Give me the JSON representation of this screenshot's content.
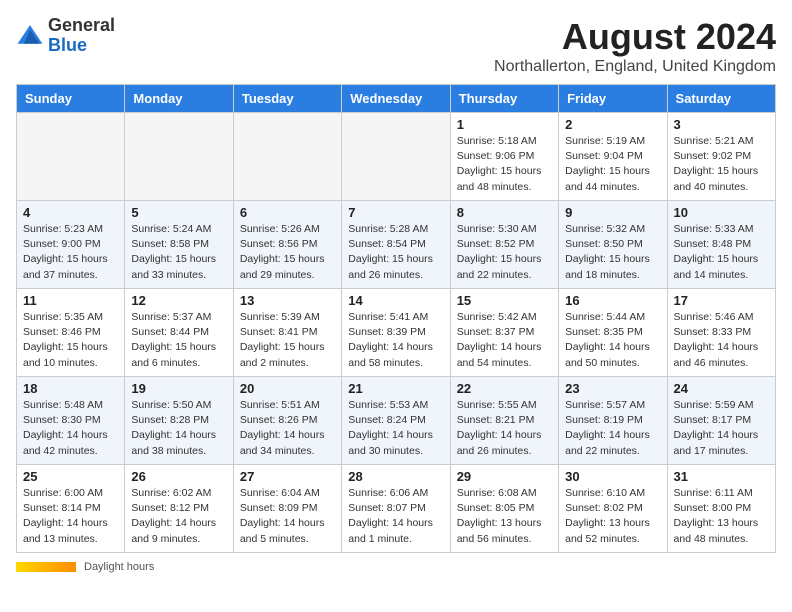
{
  "logo": {
    "general": "General",
    "blue": "Blue"
  },
  "title": "August 2024",
  "location": "Northallerton, England, United Kingdom",
  "days_of_week": [
    "Sunday",
    "Monday",
    "Tuesday",
    "Wednesday",
    "Thursday",
    "Friday",
    "Saturday"
  ],
  "footer": {
    "label": "Daylight hours"
  },
  "weeks": [
    [
      {
        "day": "",
        "info": ""
      },
      {
        "day": "",
        "info": ""
      },
      {
        "day": "",
        "info": ""
      },
      {
        "day": "",
        "info": ""
      },
      {
        "day": "1",
        "info": "Sunrise: 5:18 AM\nSunset: 9:06 PM\nDaylight: 15 hours\nand 48 minutes."
      },
      {
        "day": "2",
        "info": "Sunrise: 5:19 AM\nSunset: 9:04 PM\nDaylight: 15 hours\nand 44 minutes."
      },
      {
        "day": "3",
        "info": "Sunrise: 5:21 AM\nSunset: 9:02 PM\nDaylight: 15 hours\nand 40 minutes."
      }
    ],
    [
      {
        "day": "4",
        "info": "Sunrise: 5:23 AM\nSunset: 9:00 PM\nDaylight: 15 hours\nand 37 minutes."
      },
      {
        "day": "5",
        "info": "Sunrise: 5:24 AM\nSunset: 8:58 PM\nDaylight: 15 hours\nand 33 minutes."
      },
      {
        "day": "6",
        "info": "Sunrise: 5:26 AM\nSunset: 8:56 PM\nDaylight: 15 hours\nand 29 minutes."
      },
      {
        "day": "7",
        "info": "Sunrise: 5:28 AM\nSunset: 8:54 PM\nDaylight: 15 hours\nand 26 minutes."
      },
      {
        "day": "8",
        "info": "Sunrise: 5:30 AM\nSunset: 8:52 PM\nDaylight: 15 hours\nand 22 minutes."
      },
      {
        "day": "9",
        "info": "Sunrise: 5:32 AM\nSunset: 8:50 PM\nDaylight: 15 hours\nand 18 minutes."
      },
      {
        "day": "10",
        "info": "Sunrise: 5:33 AM\nSunset: 8:48 PM\nDaylight: 15 hours\nand 14 minutes."
      }
    ],
    [
      {
        "day": "11",
        "info": "Sunrise: 5:35 AM\nSunset: 8:46 PM\nDaylight: 15 hours\nand 10 minutes."
      },
      {
        "day": "12",
        "info": "Sunrise: 5:37 AM\nSunset: 8:44 PM\nDaylight: 15 hours\nand 6 minutes."
      },
      {
        "day": "13",
        "info": "Sunrise: 5:39 AM\nSunset: 8:41 PM\nDaylight: 15 hours\nand 2 minutes."
      },
      {
        "day": "14",
        "info": "Sunrise: 5:41 AM\nSunset: 8:39 PM\nDaylight: 14 hours\nand 58 minutes."
      },
      {
        "day": "15",
        "info": "Sunrise: 5:42 AM\nSunset: 8:37 PM\nDaylight: 14 hours\nand 54 minutes."
      },
      {
        "day": "16",
        "info": "Sunrise: 5:44 AM\nSunset: 8:35 PM\nDaylight: 14 hours\nand 50 minutes."
      },
      {
        "day": "17",
        "info": "Sunrise: 5:46 AM\nSunset: 8:33 PM\nDaylight: 14 hours\nand 46 minutes."
      }
    ],
    [
      {
        "day": "18",
        "info": "Sunrise: 5:48 AM\nSunset: 8:30 PM\nDaylight: 14 hours\nand 42 minutes."
      },
      {
        "day": "19",
        "info": "Sunrise: 5:50 AM\nSunset: 8:28 PM\nDaylight: 14 hours\nand 38 minutes."
      },
      {
        "day": "20",
        "info": "Sunrise: 5:51 AM\nSunset: 8:26 PM\nDaylight: 14 hours\nand 34 minutes."
      },
      {
        "day": "21",
        "info": "Sunrise: 5:53 AM\nSunset: 8:24 PM\nDaylight: 14 hours\nand 30 minutes."
      },
      {
        "day": "22",
        "info": "Sunrise: 5:55 AM\nSunset: 8:21 PM\nDaylight: 14 hours\nand 26 minutes."
      },
      {
        "day": "23",
        "info": "Sunrise: 5:57 AM\nSunset: 8:19 PM\nDaylight: 14 hours\nand 22 minutes."
      },
      {
        "day": "24",
        "info": "Sunrise: 5:59 AM\nSunset: 8:17 PM\nDaylight: 14 hours\nand 17 minutes."
      }
    ],
    [
      {
        "day": "25",
        "info": "Sunrise: 6:00 AM\nSunset: 8:14 PM\nDaylight: 14 hours\nand 13 minutes."
      },
      {
        "day": "26",
        "info": "Sunrise: 6:02 AM\nSunset: 8:12 PM\nDaylight: 14 hours\nand 9 minutes."
      },
      {
        "day": "27",
        "info": "Sunrise: 6:04 AM\nSunset: 8:09 PM\nDaylight: 14 hours\nand 5 minutes."
      },
      {
        "day": "28",
        "info": "Sunrise: 6:06 AM\nSunset: 8:07 PM\nDaylight: 14 hours\nand 1 minute."
      },
      {
        "day": "29",
        "info": "Sunrise: 6:08 AM\nSunset: 8:05 PM\nDaylight: 13 hours\nand 56 minutes."
      },
      {
        "day": "30",
        "info": "Sunrise: 6:10 AM\nSunset: 8:02 PM\nDaylight: 13 hours\nand 52 minutes."
      },
      {
        "day": "31",
        "info": "Sunrise: 6:11 AM\nSunset: 8:00 PM\nDaylight: 13 hours\nand 48 minutes."
      }
    ]
  ]
}
